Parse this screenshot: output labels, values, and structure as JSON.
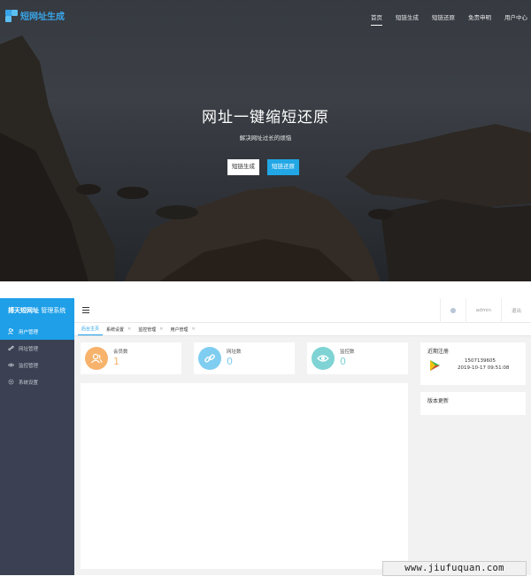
{
  "hero": {
    "logo_text": "短网址生成",
    "nav": [
      "首页",
      "短链生成",
      "短链还原",
      "免责申明",
      "用户中心"
    ],
    "title": "网址一键缩短还原",
    "subtitle": "解决网址过长的烦恼",
    "btn_generate": "短链生成",
    "btn_restore": "短链还原",
    "accent": "#22a7e6"
  },
  "admin": {
    "brand_bold": "搏天短网址",
    "brand_rest": "管理系统",
    "menu": [
      {
        "label": "用户管理",
        "icon": "user-icon"
      },
      {
        "label": "网址管理",
        "icon": "link-icon"
      },
      {
        "label": "监控管理",
        "icon": "eye-icon"
      },
      {
        "label": "系统设置",
        "icon": "gear-icon"
      }
    ],
    "top_user": "admin",
    "top_logout": "退出",
    "tabs": [
      {
        "label": "后台主页",
        "closable": false
      },
      {
        "label": "系统设置",
        "closable": true
      },
      {
        "label": "监控管理",
        "closable": true
      },
      {
        "label": "用户管理",
        "closable": true
      }
    ],
    "tab_close": "✕",
    "stats": [
      {
        "label": "会员数",
        "value": "1",
        "color": "#f7b26b"
      },
      {
        "label": "网址数",
        "value": "0",
        "color": "#7fcdf0"
      },
      {
        "label": "监控数",
        "value": "0",
        "color": "#7fd3d4"
      }
    ],
    "recent": {
      "title": "近期注册",
      "phone": "1507139605",
      "time": "2019-10-17 09:51:08"
    },
    "update_title": "版本更新",
    "sidebar_color": "#3b4152",
    "brand_color": "#1e9fe8"
  },
  "watermark": "www.jiufuquan.com"
}
